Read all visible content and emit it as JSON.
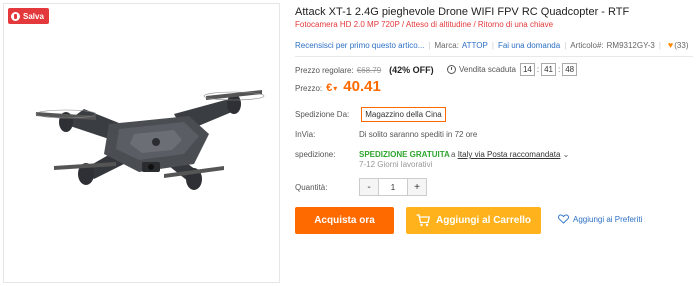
{
  "badge": {
    "label": "Salva",
    "icon": "pin-icon"
  },
  "product": {
    "title": "Attack XT-1 2.4G pieghevole Drone WIFI FPV RC Quadcopter - RTF",
    "subtitle": "Fotocamera HD 2.0 MP 720P / Atteso di altitudine / Ritorno di una chiave"
  },
  "meta": {
    "review_link": "Recensisci per primo questo artico...",
    "brand_label": "Marca:",
    "brand_value": "ATTOP",
    "question_link": "Fai una domanda",
    "article_label": "Articolo#:",
    "article_value": "RM9312GY-3",
    "favorites_count": "(33)"
  },
  "pricing": {
    "regular_label": "Prezzo regolare:",
    "regular_value": "€68.79",
    "discount": "(42% OFF)",
    "sale_label": "Vendita scaduta",
    "timer": [
      "14",
      "41",
      "48"
    ],
    "price_label": "Prezzo:",
    "currency": "€",
    "price_value": "40.41"
  },
  "shipping": {
    "from_label": "Spedizione Da:",
    "from_value": "Magazzino della Cina",
    "send_label": "InVia:",
    "send_value": "Di solito saranno spediti in 72 ore",
    "ship_label": "spedizione:",
    "free_label": "SPEDIZIONE GRATUITA",
    "via_prefix": "a",
    "via_link": "Italy via Posta raccomandata",
    "days": "7-12 Giorni lavorativi"
  },
  "quantity": {
    "label": "Quantità:",
    "minus": "-",
    "value": "1",
    "plus": "+"
  },
  "actions": {
    "buy": "Acquista ora",
    "cart": "Aggiungi al Carrello",
    "wishlist": "Aggiungi ai Preferiti"
  },
  "colors": {
    "accent": "#ff6a00",
    "cart": "#ffb21c",
    "link": "#2d70c4",
    "free": "#2ea52e",
    "badge": "#e4393c"
  }
}
